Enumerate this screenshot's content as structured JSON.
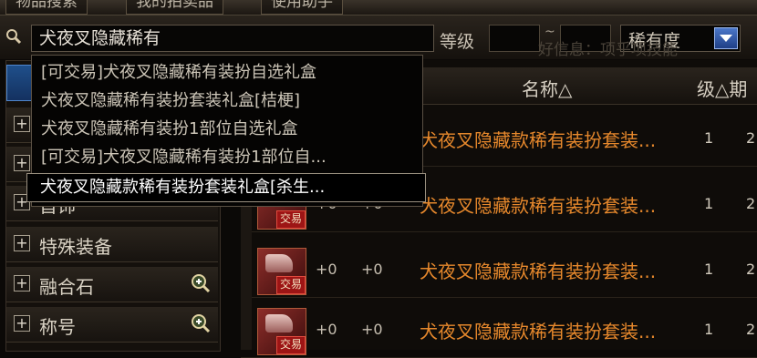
{
  "tabs": [
    "物品搜索",
    "我的拍卖品",
    "使用助手"
  ],
  "search": {
    "value": "犬夜叉隐藏稀有",
    "level_label": "等级",
    "tilde": "~",
    "rarity_label": "稀有度"
  },
  "faded_text": "好信息：项乎项技能",
  "categories": [
    {
      "label": ""
    },
    {
      "label": ""
    },
    {
      "label": "首饰"
    },
    {
      "label": "特殊装备"
    },
    {
      "label": "融合石"
    },
    {
      "label": "称号"
    }
  ],
  "table": {
    "headers": {
      "name": "名称△",
      "level": "级△期"
    },
    "rows": [
      {
        "tag": "交易",
        "plus_a": "",
        "plus_b": "",
        "name": "犬夜叉隐藏款稀有装扮套装...",
        "level": "1",
        "extra": "2"
      },
      {
        "tag": "交易",
        "plus_a": "+0",
        "plus_b": "+0",
        "name": "犬夜叉隐藏款稀有装扮套装...",
        "level": "1",
        "extra": "2"
      },
      {
        "tag": "交易",
        "plus_a": "+0",
        "plus_b": "+0",
        "name": "犬夜叉隐藏款稀有装扮套装...",
        "level": "1",
        "extra": "2"
      },
      {
        "tag": "交易",
        "plus_a": "+0",
        "plus_b": "+0",
        "name": "犬夜叉隐藏款稀有装扮套装...",
        "level": "1",
        "extra": "2"
      }
    ]
  },
  "autocomplete": [
    "[可交易]犬夜叉隐藏稀有装扮自选礼盒",
    "犬夜叉隐藏稀有装扮套装礼盒[桔梗]",
    "犬夜叉隐藏稀有装扮1部位自选礼盒",
    "[可交易]犬夜叉隐藏稀有装扮1部位自...",
    "犬夜叉隐藏款稀有装扮套装礼盒[杀生..."
  ],
  "colors": {
    "item_name": "#e6882c",
    "highlight": "#1f4f8a",
    "dropdown_button": "#3a64b8"
  }
}
